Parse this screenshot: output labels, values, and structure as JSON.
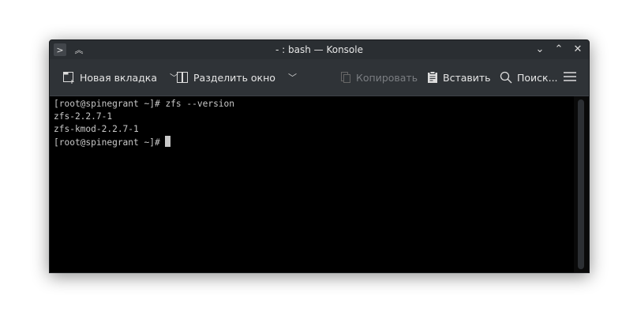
{
  "window": {
    "title": "- : bash — Konsole"
  },
  "titlebar_icons": [
    "terminal-icon",
    "keep-above-icon"
  ],
  "window_buttons": [
    "minimize",
    "maximize",
    "close"
  ],
  "toolbar": {
    "new_tab": "Новая вкладка",
    "split_view": "Разделить окно",
    "copy": "Копировать",
    "paste": "Вставить",
    "find": "Поиск..."
  },
  "terminal": {
    "lines": [
      "[root@spinegrant ~]# zfs --version",
      "zfs-2.2.7-1",
      "zfs-kmod-2.2.7-1",
      "[root@spinegrant ~]# "
    ]
  }
}
